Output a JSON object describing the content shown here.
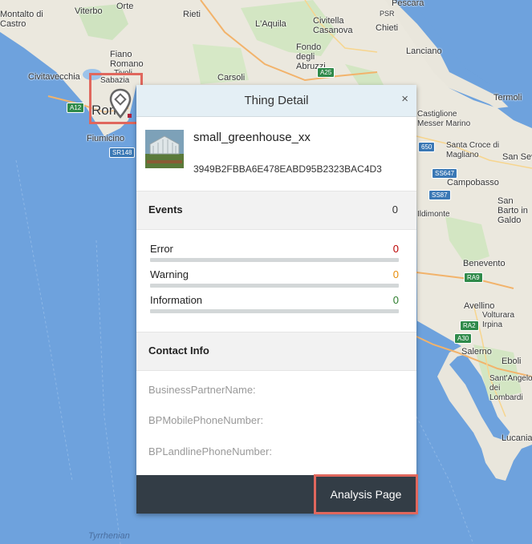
{
  "map": {
    "labels": [
      "Montalto di Castro",
      "Viterbo",
      "Orte",
      "Rieti",
      "L'Aquila",
      "Civitella Casanova",
      "PSR",
      "Pescara",
      "Chieti",
      "Fiano Romano",
      "Tivoli",
      "Tivoli",
      "Fondo degli Abruzzi",
      "Lanciano",
      "Civitavecchia",
      "Sabazia",
      "Carsoli",
      "Termoli",
      "Castiglione Messer Marino",
      "Fiumicino",
      "Santa Croce di Magliano",
      "San Sev",
      "Campobasso",
      "San Barto in Galdo",
      "Ildimonte",
      "Benevento",
      "Avellino",
      "Volturara Irpina",
      "Salerno",
      "Eboli",
      "Sant'Angelo dei Lombardi",
      "Lucania",
      "Tyrrhenian"
    ],
    "rome_label": "Rom",
    "shields": [
      "A12",
      "SR148",
      "A25",
      "SS647",
      "SS87",
      "RA9",
      "RA2",
      "A30",
      "650"
    ]
  },
  "dialog": {
    "title": "Thing Detail",
    "close_icon": "×",
    "thing": {
      "name": "small_greenhouse_xx",
      "id": "3949B2FBBA6E478EABD95B2323BAC4D3"
    },
    "events": {
      "title": "Events",
      "count": "0",
      "rows": [
        {
          "label": "Error",
          "value": "0",
          "color": "#bb0000",
          "fill": 0
        },
        {
          "label": "Warning",
          "value": "0",
          "color": "#e78c07",
          "fill": 0
        },
        {
          "label": "Information",
          "value": "0",
          "color": "#2b7c2b",
          "fill": 0
        }
      ]
    },
    "contact": {
      "title": "Contact Info",
      "fields": [
        "BusinessPartnerName:",
        "BPMobilePhoneNumber:",
        "BPLandlinePhoneNumber:"
      ]
    },
    "footer": {
      "analysis_button": "Analysis Page"
    }
  }
}
